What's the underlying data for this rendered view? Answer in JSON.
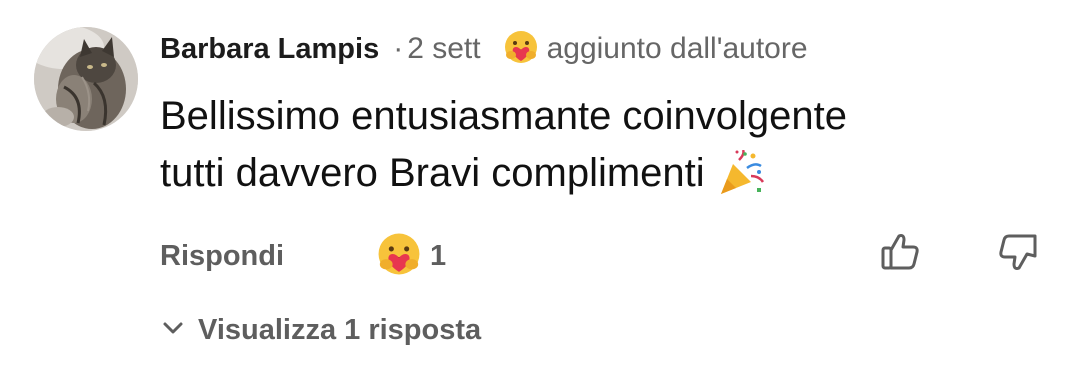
{
  "comment": {
    "author": "Barbara Lampis",
    "separator": "·",
    "time": "2 sett",
    "badge_icon": "care-reaction-icon",
    "badge_text": "aggiunto dall'autore",
    "text_line1": "Bellissimo entusiasmante coinvolgente",
    "text_line2": "tutti davvero Bravi complimenti",
    "text_emoji": "party-popper-icon"
  },
  "actions": {
    "reply_label": "Rispondi",
    "reaction_icon": "care-reaction-icon",
    "reaction_count": "1",
    "like_icon": "thumb-up-icon",
    "dislike_icon": "thumb-down-icon"
  },
  "replies": {
    "toggle_icon": "chevron-down-icon",
    "label": "Visualizza 1 risposta"
  },
  "colors": {
    "text_primary": "#1c1c1c",
    "text_secondary": "#5e5e5e",
    "reaction_face": "#f7c33b",
    "reaction_heart": "#e8364f"
  }
}
